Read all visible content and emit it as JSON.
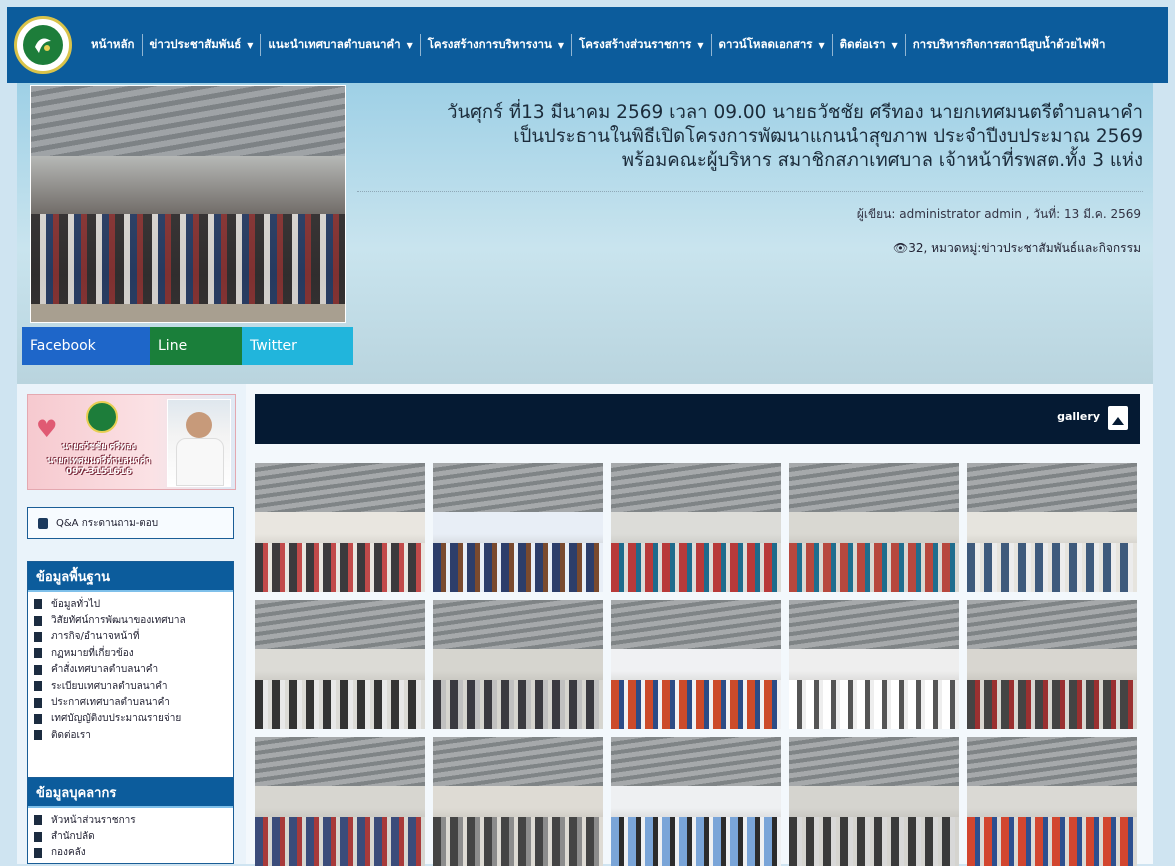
{
  "nav": {
    "items": [
      {
        "label": "หน้าหลัก",
        "dropdown": false
      },
      {
        "label": "ข่าวประชาสัมพันธ์",
        "dropdown": true
      },
      {
        "label": "แนะนำเทศบาลตำบลนาคำ",
        "dropdown": true
      },
      {
        "label": "โครงสร้างการบริหารงาน",
        "dropdown": true
      },
      {
        "label": "โครงสร้างส่วนราชการ",
        "dropdown": true
      },
      {
        "label": "ดาวน์โหลดเอกสาร",
        "dropdown": true
      },
      {
        "label": "ติดต่อเรา",
        "dropdown": true
      },
      {
        "label": "การบริหารกิจการสถานีสูบน้ำด้วยไฟฟ้า",
        "dropdown": false
      }
    ],
    "caret": "▼"
  },
  "hero": {
    "title_lines": [
      "วันศุกร์ ที่13 มีนาคม 2569 เวลา 09.00 นายธวัชชัย ศรีทอง นายกเทศมนตรีตำบลนาคำ",
      "เป็นประธานในพิธีเปิดโครงการพัฒนาแกนนำสุขภาพ ประจำปีงบประมาณ 2569",
      "พร้อมคณะผู้บริหาร สมาชิกสภาเทศบาล เจ้าหน้าที่รพสต.ทั้ง 3 แห่ง"
    ],
    "author_line": "ผู้เขียน: administrator admin , วันที่: 13 มี.ค. 2569",
    "views": "32",
    "category_line": "32, หมวดหมู่:ข่าวประชาสัมพันธ์และกิจกรรม",
    "share": {
      "facebook": "Facebook",
      "line": "Line",
      "twitter": "Twitter"
    }
  },
  "sidebar": {
    "banner": {
      "name": "นายธวัชชัย ศรีทอง",
      "position": "นายกเทศมนตรีตำบลนาคำ",
      "phone": "097-3151616"
    },
    "qa_label": "Q&A กระดานถาม-ตอบ",
    "section1": {
      "title": "ข้อมูลพื้นฐาน",
      "items": [
        "ข้อมูลทั่วไป",
        "วิสัยทัศน์การพัฒนาของเทศบาล",
        "ภารกิจ/อำนาจหน้าที่",
        "กฏหมายที่เกี่ยวข้อง",
        "คำสั่งเทศบาลตำบลนาคำ",
        "ระเบียบเทศบาลตำบลนาคำ",
        "ประกาศเทศบาลตำบลนาคำ",
        "เทศบัญญัติงบประมาณรายจ่าย",
        "ติดต่อเรา"
      ]
    },
    "section2": {
      "title": "ข้อมูลบุคลากร",
      "items": [
        "หัวหน้าส่วนราชการ",
        "สำนักปลัด",
        "กองคลัง"
      ]
    }
  },
  "gallery": {
    "label": "gallery",
    "icon": "image-file-icon",
    "thumbnail_count": 15
  },
  "colors": {
    "nav_bg": "#0c5c9c",
    "gallery_bar": "#051a33",
    "facebook": "#1e66c9",
    "line": "#1a7f3a",
    "twitter": "#21b5dc"
  }
}
